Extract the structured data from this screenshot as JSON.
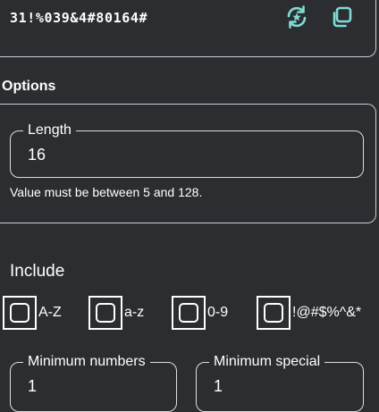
{
  "password": {
    "value": "31!%039&4#80164#"
  },
  "actions": {
    "regenerate_icon": "refresh-sparkle-icon",
    "copy_icon": "copy-icon"
  },
  "options": {
    "title": "Options",
    "length": {
      "label": "Length",
      "value": "16",
      "helper": "Value must be between 5 and 128."
    }
  },
  "include": {
    "title": "Include",
    "items": [
      {
        "label": "A-Z",
        "checked": false
      },
      {
        "label": "a-z",
        "checked": false
      },
      {
        "label": "0-9",
        "checked": false
      },
      {
        "label": "!@#$%^&*",
        "checked": false
      }
    ]
  },
  "minimums": {
    "numbers": {
      "label": "Minimum numbers",
      "value": "1"
    },
    "special": {
      "label": "Minimum special",
      "value": "1"
    }
  },
  "colors": {
    "background": "#2b2d30",
    "accent": "#7fdcd4",
    "border": "#c8cdd1"
  }
}
